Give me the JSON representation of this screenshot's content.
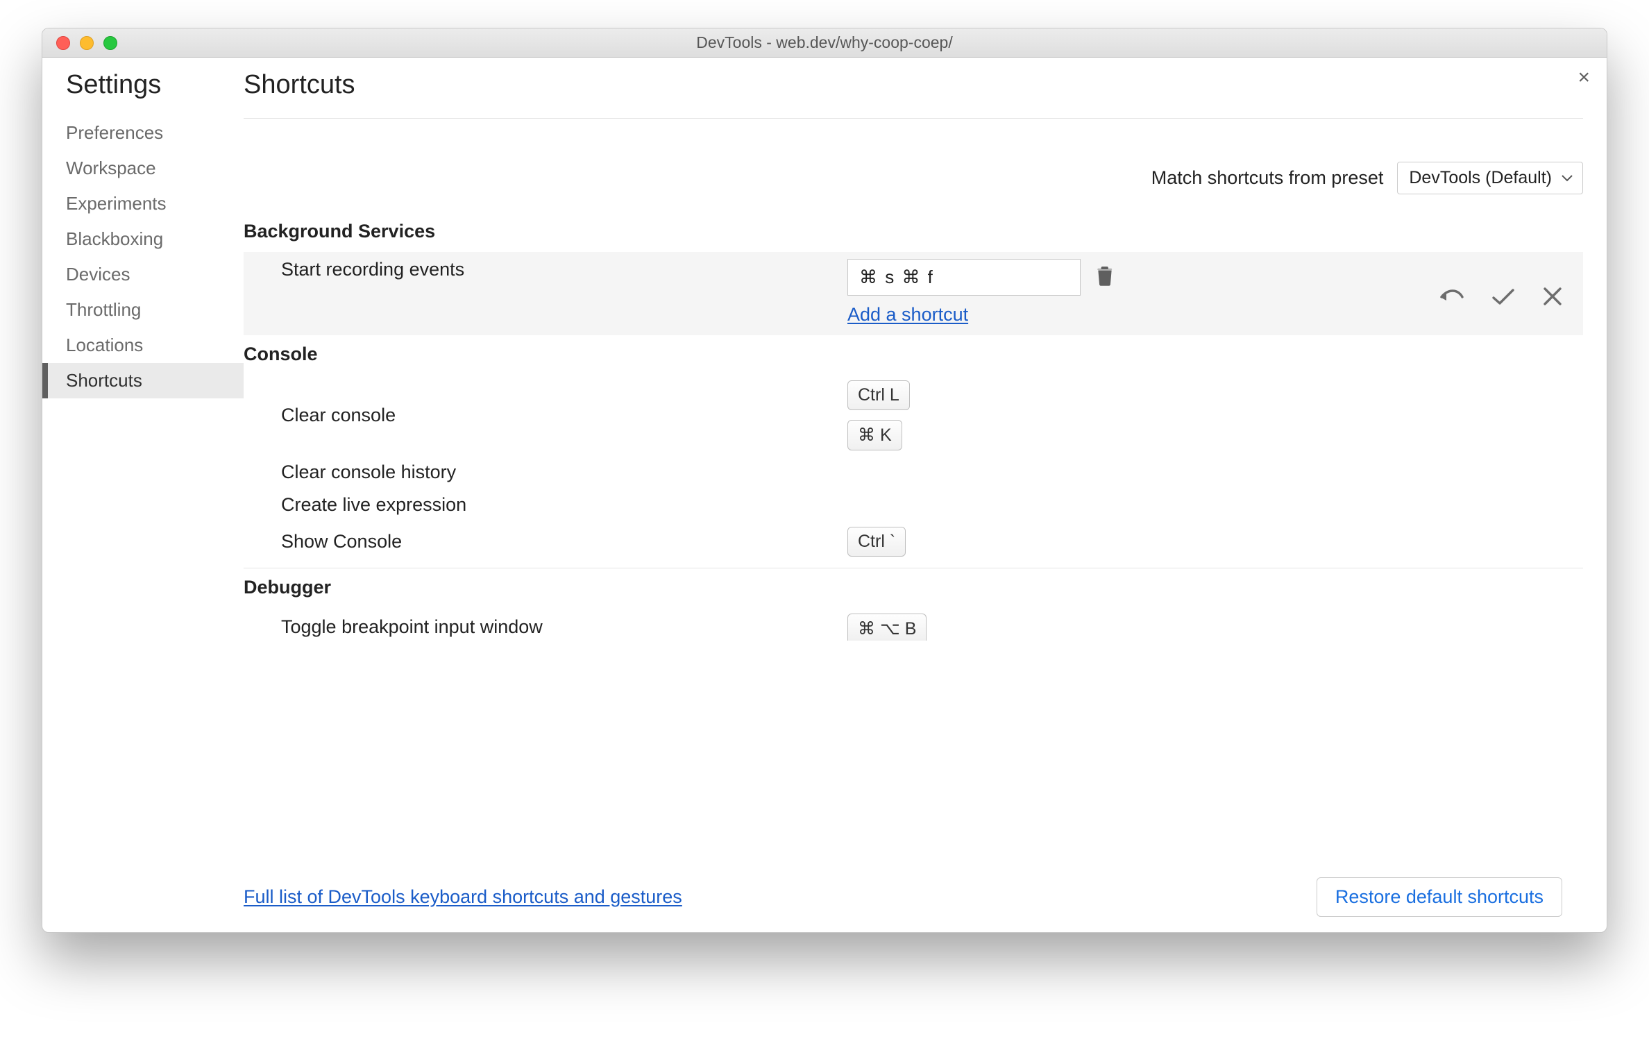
{
  "window_title": "DevTools - web.dev/why-coop-coep/",
  "sidebar": {
    "heading": "Settings",
    "items": [
      "Preferences",
      "Workspace",
      "Experiments",
      "Blackboxing",
      "Devices",
      "Throttling",
      "Locations",
      "Shortcuts"
    ],
    "active_index": 7
  },
  "page": {
    "heading": "Shortcuts",
    "preset_label": "Match shortcuts from preset",
    "preset_value": "DevTools (Default)",
    "full_list_link": "Full list of DevTools keyboard shortcuts and gestures",
    "restore_button": "Restore default shortcuts",
    "add_shortcut_label": "Add a shortcut"
  },
  "sections": [
    {
      "name": "Background Services",
      "rows": [
        {
          "label": "Start recording events",
          "editing": true,
          "input_value": "⌘ s ⌘ f"
        }
      ]
    },
    {
      "name": "Console",
      "rows": [
        {
          "label": "Clear console",
          "keys": [
            "Ctrl L",
            "⌘ K"
          ]
        },
        {
          "label": "Clear console history",
          "keys": []
        },
        {
          "label": "Create live expression",
          "keys": []
        },
        {
          "label": "Show Console",
          "keys": [
            "Ctrl `"
          ]
        }
      ]
    },
    {
      "name": "Debugger",
      "rows": [
        {
          "label": "Toggle breakpoint input window",
          "keys": [
            "⌘ ⌥ B"
          ]
        }
      ]
    }
  ]
}
